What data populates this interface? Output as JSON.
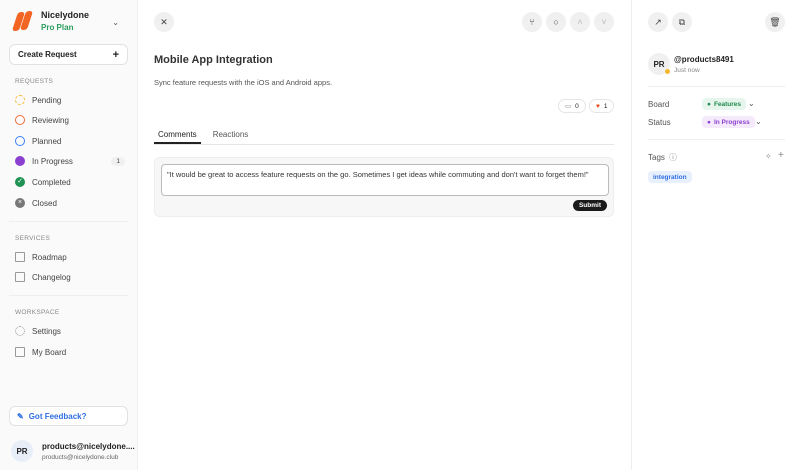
{
  "sidebar": {
    "org_name": "Nicelydone",
    "plan": "Pro Plan",
    "create_label": "Create Request",
    "requests_heading": "REQUESTS",
    "requests": [
      {
        "label": "Pending",
        "color": "#f5b82e"
      },
      {
        "label": "Reviewing",
        "color": "#f26b3a"
      },
      {
        "label": "Planned",
        "color": "#3b82f6"
      },
      {
        "label": "In Progress",
        "color": "#8b3fd1",
        "count": "1"
      },
      {
        "label": "Completed",
        "color": "#1f9254"
      },
      {
        "label": "Closed",
        "color": "#777"
      }
    ],
    "services_heading": "SERVICES",
    "services": [
      {
        "label": "Roadmap"
      },
      {
        "label": "Changelog"
      }
    ],
    "workspace_heading": "WORKSPACE",
    "workspace": [
      {
        "label": "Settings"
      },
      {
        "label": "My Board"
      }
    ],
    "feedback_label": "Got Feedback?",
    "user": {
      "initials": "PR",
      "name": "products@nicelydone....",
      "email": "products@nicelydone.club"
    }
  },
  "main": {
    "title": "Mobile App Integration",
    "description": "Sync feature requests with the iOS and Android apps.",
    "comment_count": "0",
    "reaction_count": "1",
    "tabs": [
      "Comments",
      "Reactions"
    ],
    "comment_value": "\"It would be great to access feature requests on the go. Sometimes I get ideas while commuting and don't want to forget them!\"",
    "submit_label": "Submit"
  },
  "details": {
    "author_initials": "PR",
    "author": "@products8491",
    "time": "Just now",
    "board_label": "Board",
    "board_value": "Features",
    "status_label": "Status",
    "status_value": "In Progress",
    "tags_label": "Tags",
    "tags": [
      "integration"
    ]
  }
}
